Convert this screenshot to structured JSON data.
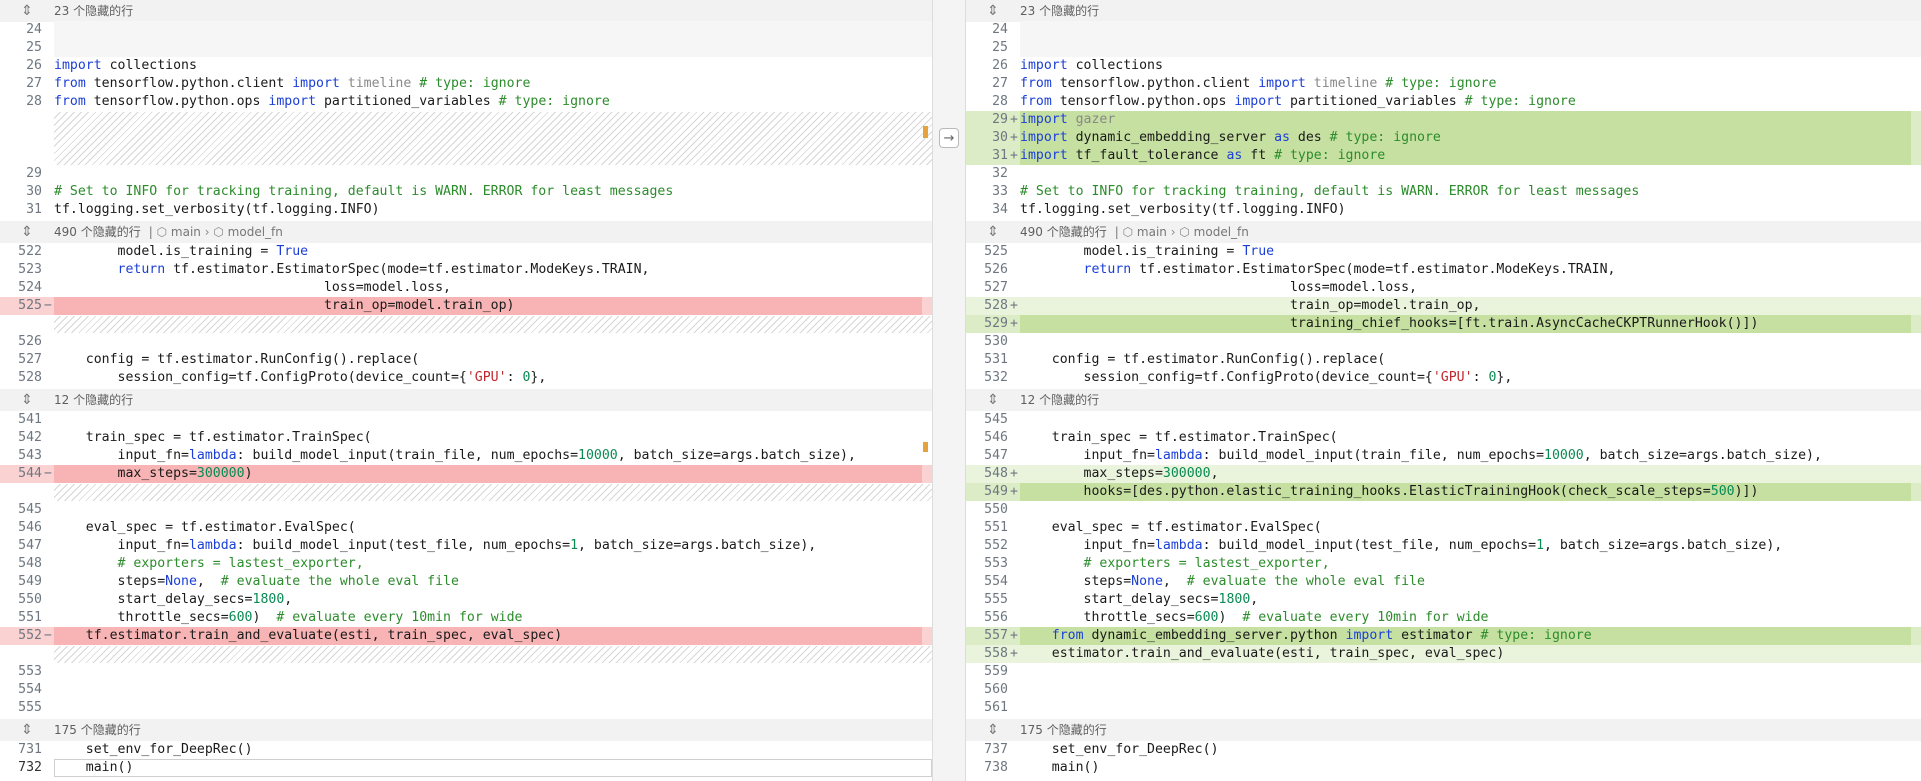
{
  "gutter": {
    "apply_icon": "arrow-right-icon"
  },
  "left": {
    "folds": [
      {
        "label": "23 个隐藏的行"
      },
      {
        "label": "490 个隐藏的行",
        "crumb_main": "main",
        "crumb_fn": "model_fn"
      },
      {
        "label": "12 个隐藏的行"
      },
      {
        "label": "175 个隐藏的行"
      }
    ],
    "lines": {
      "l24": "24",
      "l25": "25",
      "l26": "26",
      "l27": "27",
      "l28": "28",
      "l29": "29",
      "l30": "30",
      "l31": "31",
      "l522": "522",
      "l523": "523",
      "l524": "524",
      "l525": "525",
      "l526": "526",
      "l527": "527",
      "l528": "528",
      "l541": "541",
      "l542": "542",
      "l543": "543",
      "l544": "544",
      "l545": "545",
      "l546": "546",
      "l547": "547",
      "l548": "548",
      "l549": "549",
      "l550": "550",
      "l551": "551",
      "l552": "552",
      "l553": "553",
      "l554": "554",
      "l555": "555",
      "l731": "731",
      "l732": "732"
    }
  },
  "right": {
    "folds": [
      {
        "label": "23 个隐藏的行"
      },
      {
        "label": "490 个隐藏的行",
        "crumb_main": "main",
        "crumb_fn": "model_fn"
      },
      {
        "label": "12 个隐藏的行"
      },
      {
        "label": "175 个隐藏的行"
      }
    ],
    "lines": {
      "r24": "24",
      "r25": "25",
      "r26": "26",
      "r27": "27",
      "r28": "28",
      "r29": "29",
      "r30": "30",
      "r31": "31",
      "r32": "32",
      "r33": "33",
      "r34": "34",
      "r525": "525",
      "r526": "526",
      "r527": "527",
      "r528": "528",
      "r529": "529",
      "r530": "530",
      "r531": "531",
      "r532": "532",
      "r545": "545",
      "r546": "546",
      "r547": "547",
      "r548": "548",
      "r549": "549",
      "r550": "550",
      "r551": "551",
      "r552": "552",
      "r553": "553",
      "r554": "554",
      "r555": "555",
      "r556": "556",
      "r557": "557",
      "r558": "558",
      "r559": "559",
      "r560": "560",
      "r561": "561",
      "r737": "737",
      "r738": "738"
    }
  },
  "code": {
    "import": "import",
    "from": "from",
    "as": "as",
    "lambda": "lambda",
    "return": "return",
    "true": "True",
    "none": "None",
    "collections": " collections",
    "tf_client": " tensorflow.python.client ",
    "timeline": " timeline",
    "type_ignore": " # type: ignore",
    "tf_ops": " tensorflow.python.ops ",
    "partitioned": " partitioned_variables",
    "gazer": " gazer",
    "des_mod": " dynamic_embedding_server ",
    "des": " des",
    "ft_mod": " tf_fault_tolerance ",
    "ft": " ft",
    "comment_info": "# Set to INFO for tracking training, default is WARN. ERROR for least messages",
    "verbosity": "tf.logging.set_verbosity(tf.logging.INFO)",
    "is_training": "        model.is_training = ",
    "return_pre": "        ",
    "estimator_spec": " tf.estimator.EstimatorSpec(mode=tf.estimator.ModeKeys.TRAIN,",
    "loss": "                                  loss=model.loss,",
    "train_op_old": "                                  train_op=model.train_op)",
    "train_op_new": "                                  train_op=model.train_op,",
    "chief_hooks": "                                  training_chief_hooks=[ft.train.AsyncCacheCKPTRunnerHook()])",
    "run_config": "    config = tf.estimator.RunConfig().replace(",
    "session_config_pre": "        session_config=tf.ConfigProto(device_count={",
    "gpu_str": "'GPU'",
    "gpu_val_pre": ": ",
    "zero": "0",
    "session_config_post": "},",
    "train_spec": "    train_spec = tf.estimator.TrainSpec(",
    "input_fn_pre": "        input_fn=",
    "train_input_a": ": build_model_input(train_file, num_epochs=",
    "n10000": "10000",
    "batch_tail": ", batch_size=args.batch_size),",
    "max_steps_pre": "        max_steps=",
    "n300000": "300000",
    "close_paren": ")",
    "comma": ",",
    "hooks_pre": "        hooks=[des.python.elastic_training_hooks.ElasticTrainingHook(check_scale_steps=",
    "n500": "500",
    "hooks_post": ")])",
    "eval_spec": "    eval_spec = tf.estimator.EvalSpec(",
    "test_input_a": ": build_model_input(test_file, num_epochs=",
    "n1": "1",
    "exporters": "        # exporters = lastest_exporter,",
    "steps_pre": "        steps=",
    "steps_post": ",  ",
    "steps_cm": "# evaluate the whole eval file",
    "start_delay_pre": "        start_delay_secs=",
    "n1800": "1800",
    "throttle_pre": "        throttle_secs=",
    "n600": "600",
    "throttle_post": ")  ",
    "throttle_cm": "# evaluate every 10min for wide",
    "train_eval_old": "    tf.estimator.train_and_evaluate(esti, train_spec, eval_spec)",
    "from_pre": "    ",
    "des_py": " dynamic_embedding_server.python ",
    "estimator": " estimator",
    "train_eval_new": "    estimator.train_and_evaluate(esti, train_spec, eval_spec)",
    "set_env": "    set_env_for_DeepRec",
    "parens": "()",
    "main": "    main"
  }
}
